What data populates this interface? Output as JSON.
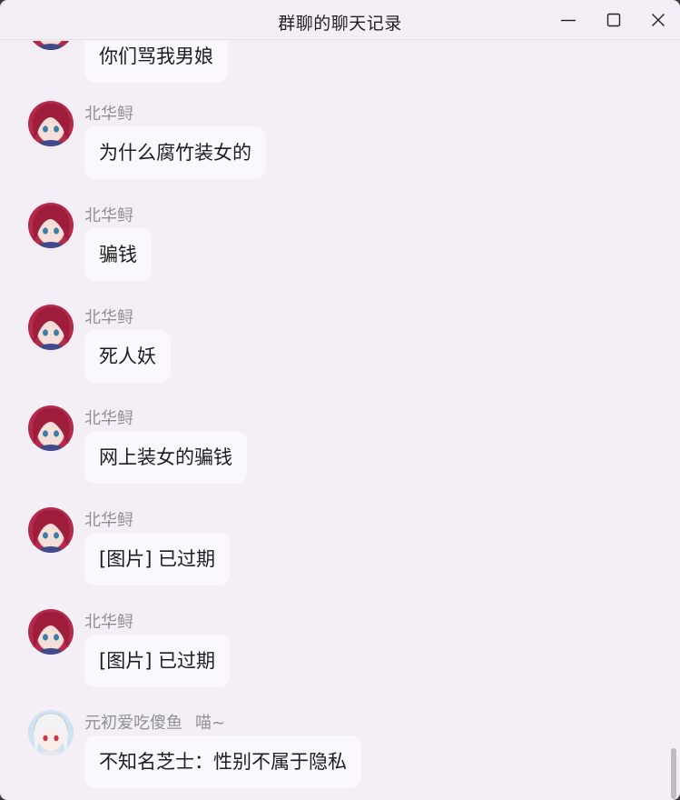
{
  "window": {
    "title": "群聊的聊天记录",
    "controls": {
      "minimize_icon": "minimize-icon",
      "maximize_icon": "maximize-icon",
      "close_icon": "close-icon"
    }
  },
  "colors": {
    "background": "#f4eff7",
    "bubble": "#fbf8fd",
    "sender_name": "#8f8f96",
    "text": "#1d1d1d"
  },
  "messages": [
    {
      "sender": "",
      "sender_title": "",
      "text": "你们骂我男娘",
      "avatar": "red-haired-anime-avatar"
    },
    {
      "sender": "北华鲟",
      "sender_title": "",
      "text": "为什么腐竹装女的",
      "avatar": "red-haired-anime-avatar"
    },
    {
      "sender": "北华鲟",
      "sender_title": "",
      "text": "骗钱",
      "avatar": "red-haired-anime-avatar"
    },
    {
      "sender": "北华鲟",
      "sender_title": "",
      "text": "死人妖",
      "avatar": "red-haired-anime-avatar"
    },
    {
      "sender": "北华鲟",
      "sender_title": "",
      "text": "网上装女的骗钱",
      "avatar": "red-haired-anime-avatar"
    },
    {
      "sender": "北华鲟",
      "sender_title": "",
      "text": "[图片] 已过期",
      "avatar": "red-haired-anime-avatar"
    },
    {
      "sender": "北华鲟",
      "sender_title": "",
      "text": "[图片] 已过期",
      "avatar": "red-haired-anime-avatar"
    },
    {
      "sender": "元初爱吃傻鱼",
      "sender_title": "喵~",
      "text": "不知名芝士：性别不属于隐私",
      "avatar": "white-haired-anime-avatar"
    }
  ]
}
